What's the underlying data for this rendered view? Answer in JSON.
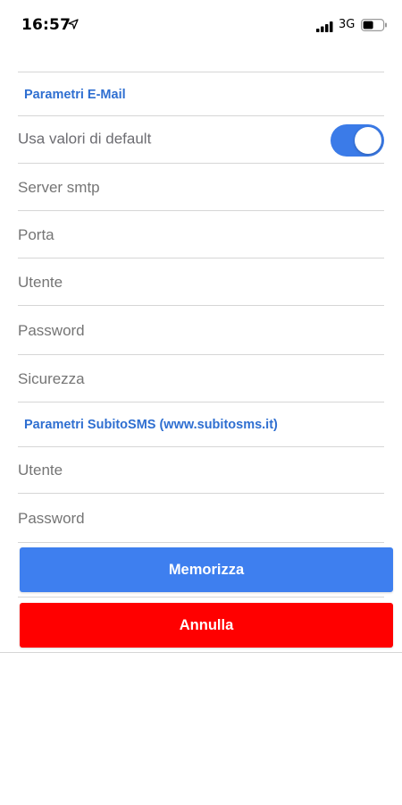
{
  "status_bar": {
    "time": "16:57",
    "network": "3G",
    "icons": [
      "location-arrow-icon",
      "signal-bars-icon",
      "battery-icon"
    ]
  },
  "email_section": {
    "header": "Parametri E-Mail",
    "use_defaults_label": "Usa valori di default",
    "use_defaults_on": true,
    "smtp_server_placeholder": "Server smtp",
    "port_placeholder": "Porta",
    "user_placeholder": "Utente",
    "password_placeholder": "Password",
    "security_placeholder": "Sicurezza"
  },
  "sms_section": {
    "header": "Parametri SubitoSMS (www.subitosms.it)",
    "user_placeholder": "Utente",
    "password_placeholder": "Password"
  },
  "actions": {
    "save_label": "Memorizza",
    "cancel_label": "Annulla"
  },
  "colors": {
    "accent": "#3e7fef",
    "header_text": "#2f6fd1",
    "cancel": "#ff0000",
    "toggle_on": "#3b7be8"
  }
}
